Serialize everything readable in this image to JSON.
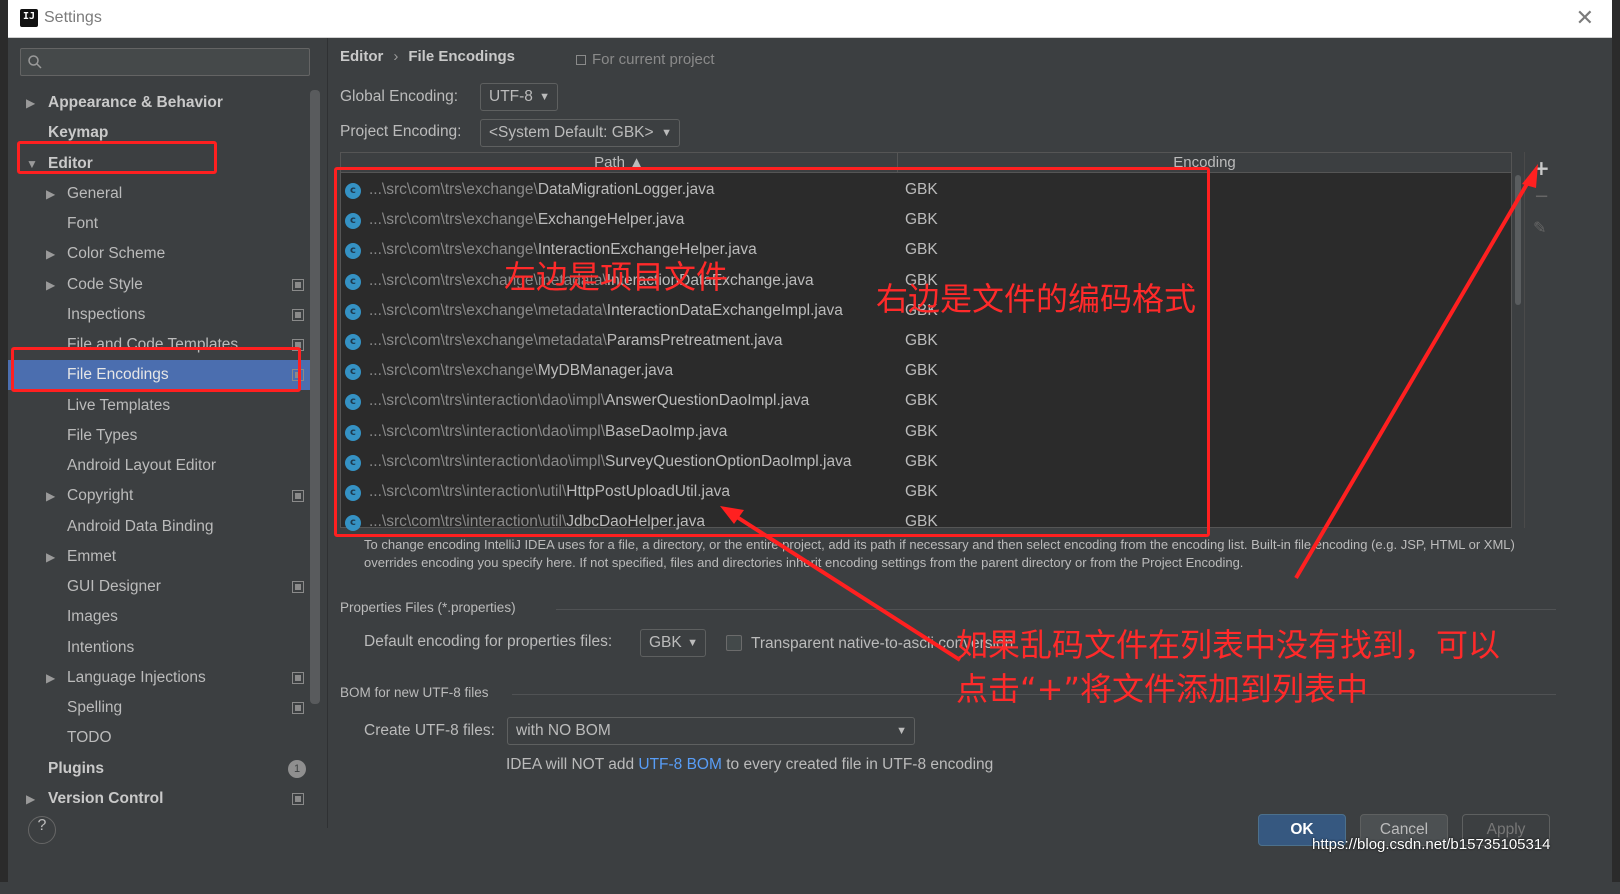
{
  "window": {
    "title": "Settings",
    "close_glyph": "✕"
  },
  "search": {
    "placeholder": ""
  },
  "sidebar": {
    "items": [
      {
        "label": "Appearance & Behavior"
      },
      {
        "label": "Keymap"
      },
      {
        "label": "Editor"
      },
      {
        "label": "General"
      },
      {
        "label": "Font"
      },
      {
        "label": "Color Scheme"
      },
      {
        "label": "Code Style"
      },
      {
        "label": "Inspections"
      },
      {
        "label": "File and Code Templates"
      },
      {
        "label": "File Encodings"
      },
      {
        "label": "Live Templates"
      },
      {
        "label": "File Types"
      },
      {
        "label": "Android Layout Editor"
      },
      {
        "label": "Copyright"
      },
      {
        "label": "Android Data Binding"
      },
      {
        "label": "Emmet"
      },
      {
        "label": "GUI Designer"
      },
      {
        "label": "Images"
      },
      {
        "label": "Intentions"
      },
      {
        "label": "Language Injections"
      },
      {
        "label": "Spelling"
      },
      {
        "label": "TODO"
      },
      {
        "label": "Plugins",
        "badge": "1"
      },
      {
        "label": "Version Control"
      }
    ]
  },
  "breadcrumb": {
    "parent": "Editor",
    "current": "File Encodings",
    "sep": "›"
  },
  "for_current_project": "For current project",
  "global_encoding": {
    "label": "Global Encoding:",
    "value": "UTF-8"
  },
  "project_encoding": {
    "label": "Project Encoding:",
    "value": "<System Default: GBK>"
  },
  "table": {
    "headers": {
      "path": "Path ▲",
      "encoding": "Encoding"
    },
    "rows": [
      {
        "dir": "...\\src\\com\\trs\\exchange\\",
        "file": "DataMigrationLogger.java",
        "encoding": "GBK"
      },
      {
        "dir": "...\\src\\com\\trs\\exchange\\",
        "file": "ExchangeHelper.java",
        "encoding": "GBK"
      },
      {
        "dir": "...\\src\\com\\trs\\exchange\\",
        "file": "InteractionExchangeHelper.java",
        "encoding": "GBK"
      },
      {
        "dir": "...\\src\\com\\trs\\exchange\\metadata\\",
        "file": "InteractionDataExchange.java",
        "encoding": "GBK"
      },
      {
        "dir": "...\\src\\com\\trs\\exchange\\metadata\\",
        "file": "InteractionDataExchangeImpl.java",
        "encoding": "GBK"
      },
      {
        "dir": "...\\src\\com\\trs\\exchange\\metadata\\",
        "file": "ParamsPretreatment.java",
        "encoding": "GBK"
      },
      {
        "dir": "...\\src\\com\\trs\\exchange\\",
        "file": "MyDBManager.java",
        "encoding": "GBK"
      },
      {
        "dir": "...\\src\\com\\trs\\interaction\\dao\\impl\\",
        "file": "AnswerQuestionDaoImpl.java",
        "encoding": "GBK"
      },
      {
        "dir": "...\\src\\com\\trs\\interaction\\dao\\impl\\",
        "file": "BaseDaoImp.java",
        "encoding": "GBK"
      },
      {
        "dir": "...\\src\\com\\trs\\interaction\\dao\\impl\\",
        "file": "SurveyQuestionOptionDaoImpl.java",
        "encoding": "GBK"
      },
      {
        "dir": "...\\src\\com\\trs\\interaction\\util\\",
        "file": "HttpPostUploadUtil.java",
        "encoding": "GBK"
      },
      {
        "dir": "...\\src\\com\\trs\\interaction\\util\\",
        "file": "JdbcDaoHelper.java",
        "encoding": "GBK"
      }
    ],
    "tools": {
      "add": "+",
      "remove": "−",
      "edit": "✎"
    }
  },
  "help_text": "To change encoding IntelliJ IDEA uses for a file, a directory, or the entire project, add its path if necessary and then select encoding from the encoding list. Built-in file encoding (e.g. JSP, HTML or XML) overrides encoding you specify here. If not specified, files and directories inherit encoding settings from the parent directory or from the Project Encoding.",
  "properties": {
    "section": "Properties Files (*.properties)",
    "label": "Default encoding for properties files:",
    "value": "GBK",
    "checkbox_label": "Transparent native-to-ascii conversion"
  },
  "bom": {
    "section": "BOM for new UTF-8 files",
    "label": "Create UTF-8 files:",
    "value": "with NO BOM",
    "note_pre": "IDEA will NOT add ",
    "note_link": "UTF-8 BOM",
    "note_post": " to every created file in UTF-8 encoding"
  },
  "buttons": {
    "ok": "OK",
    "cancel": "Cancel",
    "apply": "Apply",
    "help": "?"
  },
  "annotations": {
    "left_note": "左边是项目文件",
    "right_note": "右边是文件的编码格式",
    "bottom_note_line1": "如果乱码文件在列表中没有找到，可以",
    "bottom_note_line2": "点击“+”将文件添加到列表中"
  },
  "watermark": "https://blog.csdn.net/b15735105314",
  "colors": {
    "selection": "#4b6eaf",
    "annotation": "#ff2020",
    "link": "#589df6",
    "ok_button": "#365880"
  }
}
